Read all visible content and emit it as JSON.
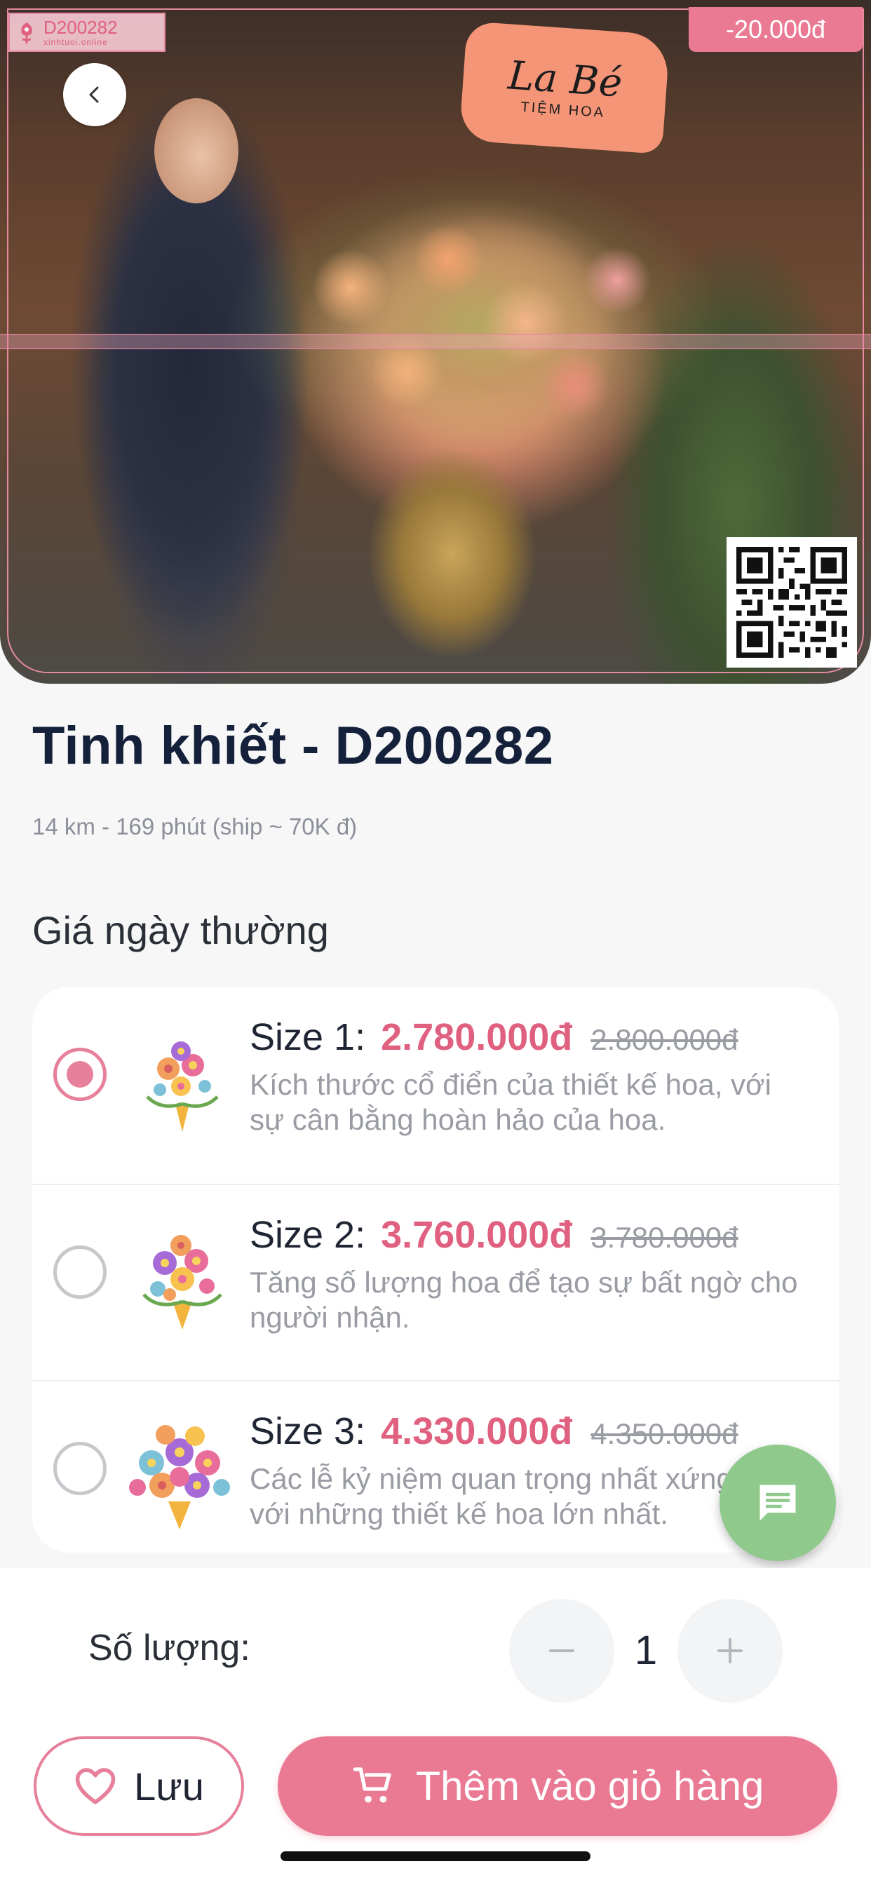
{
  "product": {
    "code_badge": "D200282",
    "code_badge_site": "xinhtuoi.online",
    "discount": "-20.000đ",
    "shop_sign_name": "La Bé",
    "shop_sign_sub": "TIỆM HOA",
    "title": "Tinh khiết - D200282",
    "distance": "14 km - 169 phút (ship ~ 70K đ)"
  },
  "pricing": {
    "section_title": "Giá ngày thường",
    "sizes": [
      {
        "label": "Size 1:",
        "price": "2.780.000đ",
        "old_price": "2.800.000đ",
        "description": "Kích thước cổ điển của thiết kế hoa, với sự cân bằng hoàn hảo của hoa.",
        "selected": true
      },
      {
        "label": "Size 2:",
        "price": "3.760.000đ",
        "old_price": "3.780.000đ",
        "description": "Tăng số lượng hoa để tạo sự bất ngờ cho người nhận.",
        "selected": false
      },
      {
        "label": "Size 3:",
        "price": "4.330.000đ",
        "old_price": "4.350.000đ",
        "description": "Các lễ kỷ niệm quan trọng nhất xứng đáng với những thiết kế hoa lớn nhất.",
        "selected": false
      }
    ]
  },
  "quantity": {
    "label": "Số lượng:",
    "value": "1"
  },
  "actions": {
    "save_label": "Lưu",
    "add_to_cart_label": "Thêm vào giỏ hàng"
  },
  "colors": {
    "accent": "#ea7a93",
    "price": "#e0607f",
    "chat_fab": "#8fc98b",
    "title": "#15213a"
  },
  "icons": {
    "back": "chevron-left-icon",
    "chat": "chat-bubble-icon",
    "minus": "minus-icon",
    "plus": "plus-icon",
    "heart": "heart-icon",
    "cart": "cart-add-icon"
  }
}
